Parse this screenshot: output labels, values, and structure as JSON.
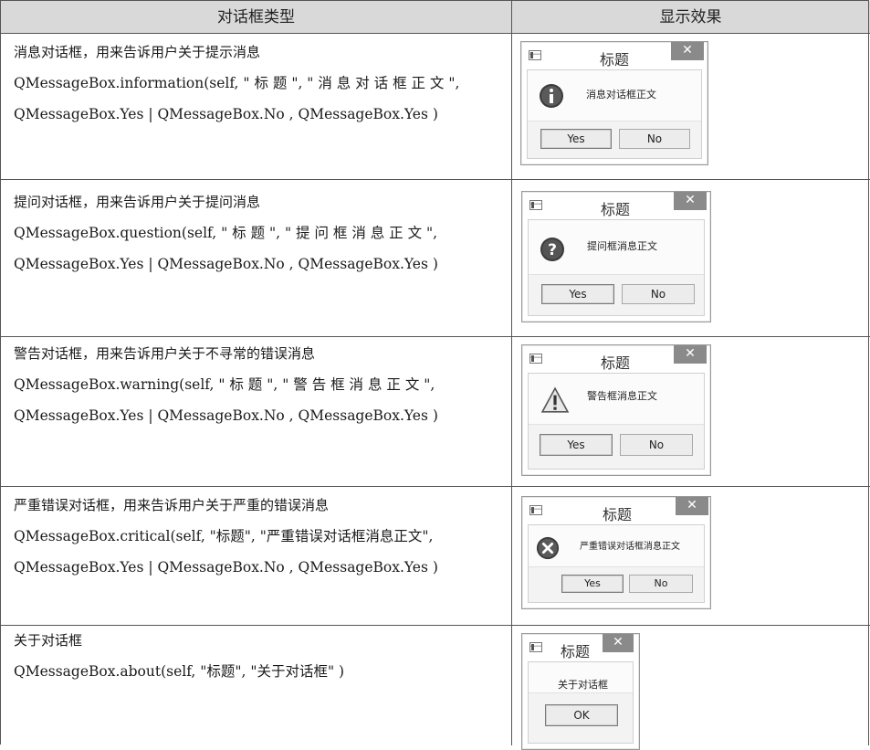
{
  "header": {
    "col_type": "对话框类型",
    "col_effect": "显示效果"
  },
  "rows": [
    {
      "desc": "消息对话框，用来告诉用户关于提示消息",
      "code1": "QMessageBox.information(self,  \" 标 题 \",  \" 消 息 对 话 框 正 文 \",",
      "code2": "QMessageBox.Yes | QMessageBox.No ,    QMessageBox.Yes )",
      "dialog": {
        "title": "标题",
        "close": "✕",
        "icon": "information-icon",
        "message": "消息对话框正文",
        "buttons": [
          "Yes",
          "No"
        ]
      }
    },
    {
      "desc": "提问对话框，用来告诉用户关于提问消息",
      "code1": "QMessageBox.question(self,   \" 标 题 \",   \" 提 问 框 消 息 正 文 \",",
      "code2": "QMessageBox.Yes | QMessageBox.No ,    QMessageBox.Yes )",
      "dialog": {
        "title": "标题",
        "close": "✕",
        "icon": "question-icon",
        "message": "提问框消息正文",
        "buttons": [
          "Yes",
          "No"
        ]
      }
    },
    {
      "desc": "警告对话框，用来告诉用户关于不寻常的错误消息",
      "code1": "QMessageBox.warning(self,   \" 标 题 \",   \" 警 告 框 消 息 正 文 \",",
      "code2": "QMessageBox.Yes | QMessageBox.No ,    QMessageBox.Yes )",
      "dialog": {
        "title": "标题",
        "close": "✕",
        "icon": "warning-icon",
        "message": "警告框消息正文",
        "buttons": [
          "Yes",
          "No"
        ]
      }
    },
    {
      "desc": "严重错误对话框，用来告诉用户关于严重的错误消息",
      "code1": "QMessageBox.critical(self,  \"标题\",  \"严重错误对话框消息正文\",",
      "code2": "QMessageBox.Yes | QMessageBox.No ,    QMessageBox.Yes )",
      "dialog": {
        "title": "标题",
        "close": "✕",
        "icon": "critical-icon",
        "message": "严重错误对话框消息正文",
        "buttons": [
          "Yes",
          "No"
        ]
      }
    },
    {
      "desc": "关于对话框",
      "code1": "QMessageBox.about(self, \"标题\", \"关于对话框\" )",
      "dialog": {
        "title": "标题",
        "close": "✕",
        "message": "关于对话框",
        "buttons": [
          "OK"
        ]
      }
    }
  ]
}
